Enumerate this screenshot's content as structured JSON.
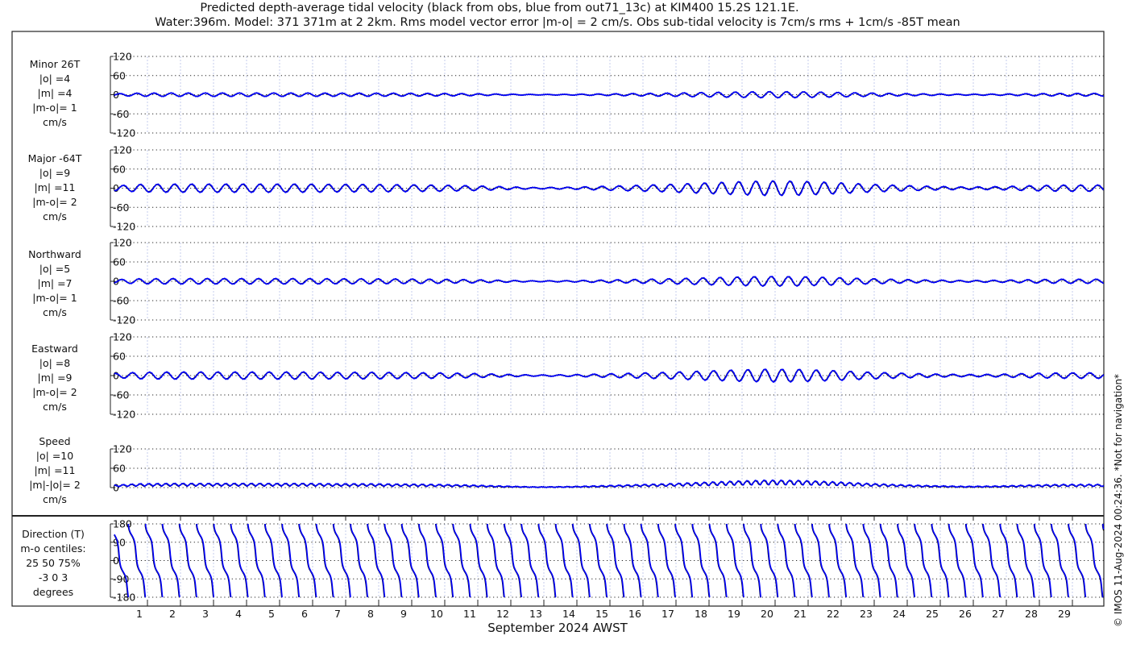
{
  "chart_data": {
    "type": "line",
    "title": [
      "Predicted depth-average tidal velocity (black from obs, blue from out71_13c) at KIM400 15.2S 121.1E.",
      "Water:396m. Model: 371 371m at 2 2km. Rms model vector error |m-o| = 2 cm/s. Obs sub-tidal velocity is 7cm/s rms + 1cm/s -85T mean"
    ],
    "xlabel": "September 2024 AWST",
    "x_ticks": [
      "1",
      "2",
      "3",
      "4",
      "5",
      "6",
      "7",
      "8",
      "9",
      "10",
      "11",
      "12",
      "13",
      "14",
      "15",
      "16",
      "17",
      "18",
      "19",
      "20",
      "21",
      "22",
      "23",
      "24",
      "25",
      "26",
      "27",
      "28",
      "29"
    ],
    "xlim_days": [
      0.24,
      30.2
    ],
    "grid": true,
    "tidal_period_hours": 12.42,
    "series_colors": {
      "obs": "#000000",
      "model": "#0000ff"
    },
    "major_amplitude_envelope_days": [
      0,
      1,
      2,
      3,
      4,
      5,
      6,
      7,
      8,
      9,
      10,
      11,
      12,
      13,
      14,
      15,
      16,
      17,
      18,
      19,
      20,
      21,
      22,
      23,
      24,
      25,
      26,
      27,
      28,
      29,
      30,
      31
    ],
    "major_amplitude_model_cm_s": [
      6,
      12,
      13,
      13,
      13,
      13,
      13,
      12,
      12,
      11,
      10,
      8,
      5,
      2,
      3,
      6,
      9,
      12,
      16,
      20,
      23,
      22,
      18,
      13,
      9,
      6,
      4,
      5,
      8,
      10,
      10,
      10
    ],
    "major_amplitude_obs_cm_s": [
      6,
      11,
      12,
      12,
      12,
      12,
      12,
      11,
      11,
      10,
      9,
      7,
      4,
      2,
      3,
      5,
      8,
      11,
      15,
      19,
      22,
      21,
      17,
      12,
      8,
      5,
      3,
      4,
      7,
      9,
      9,
      9
    ],
    "panels": [
      {
        "key": "minor",
        "label": [
          "Minor 26T",
          "|o| =4",
          "|m| =4",
          "|m-o|= 1",
          "cm/s"
        ],
        "yticks": [
          "120",
          "60",
          "0",
          "-60",
          "-120"
        ],
        "ylim": [
          -120,
          120
        ]
      },
      {
        "key": "major",
        "label": [
          "Major -64T",
          "|o| =9",
          "|m| =11",
          "|m-o|= 2",
          "cm/s"
        ],
        "yticks": [
          "120",
          "60",
          "0",
          "-60",
          "-120"
        ],
        "ylim": [
          -120,
          120
        ]
      },
      {
        "key": "north",
        "label": [
          "Northward",
          "|o| =5",
          "|m| =7",
          "|m-o|= 1",
          "cm/s"
        ],
        "yticks": [
          "120",
          "60",
          "0",
          "-60",
          "-120"
        ],
        "ylim": [
          -120,
          120
        ]
      },
      {
        "key": "east",
        "label": [
          "Eastward",
          "|o| =8",
          "|m| =9",
          "|m-o|= 2",
          "cm/s"
        ],
        "yticks": [
          "120",
          "60",
          "0",
          "-60",
          "-120"
        ],
        "ylim": [
          -120,
          120
        ]
      },
      {
        "key": "speed",
        "label": [
          "Speed",
          "|o| =10",
          "|m| =11",
          "|m|-|o|= 2",
          "cm/s"
        ],
        "yticks": [
          "120",
          "60",
          "0"
        ],
        "ylim": [
          0,
          120
        ]
      },
      {
        "key": "dir",
        "label": [
          "Direction (T)",
          "m-o centiles:",
          "25  50  75%",
          "-3  0  3",
          "degrees"
        ],
        "yticks": [
          "180",
          "90",
          "0",
          "-90",
          "-180"
        ],
        "ylim": [
          -180,
          180
        ]
      }
    ]
  },
  "footer": {
    "copyright": "© IMOS 11-Aug-2024 00:24:36. *Not for navigation*"
  }
}
